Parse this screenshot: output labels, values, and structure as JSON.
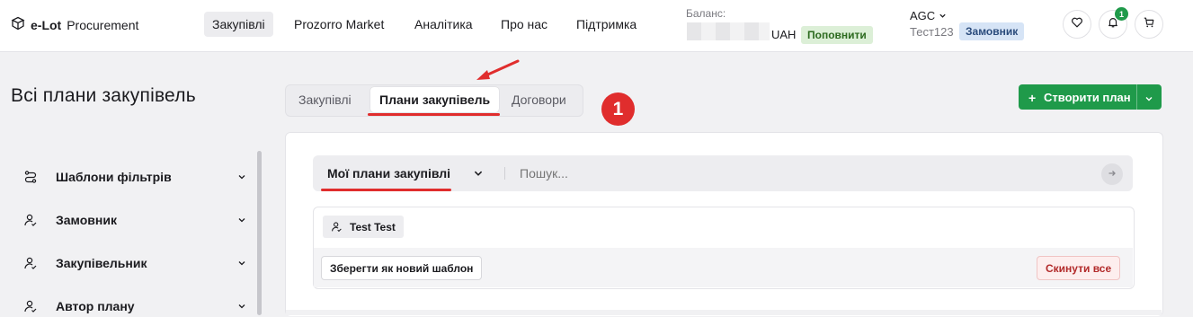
{
  "header": {
    "logo_text": "e-Lot",
    "logo_sub": "Procurement",
    "nav": [
      "Закупівлі",
      "Prozorro Market",
      "Аналітика",
      "Про нас",
      "Підтримка"
    ],
    "balance_label": "Баланс:",
    "currency": "UAH",
    "topup_label": "Поповнити",
    "org": "AGC",
    "user": "Тест123",
    "role": "Замовник",
    "notifications_count": "1"
  },
  "page": {
    "title": "Всі плани закупівель",
    "tabs": [
      "Закупівлі",
      "Плани закупівель",
      "Договори"
    ],
    "active_tab": "Плани закупівель",
    "step_marker": "1",
    "create_label": "Створити план"
  },
  "sidebar": {
    "items": [
      {
        "label": "Шаблони фільтрів",
        "icon": "route-icon"
      },
      {
        "label": "Замовник",
        "icon": "user-icon"
      },
      {
        "label": "Закупівельник",
        "icon": "user-icon"
      },
      {
        "label": "Автор плану",
        "icon": "user-icon"
      }
    ]
  },
  "search": {
    "filter_label": "Мої плани закупівлі",
    "placeholder": "Пошук..."
  },
  "filters": {
    "chip": "Test Test",
    "save_template": "Зберегти як новий шаблон",
    "reset": "Скинути все"
  },
  "colors": {
    "accent": "#1f9a4a",
    "annotation": "#e02d2d"
  }
}
